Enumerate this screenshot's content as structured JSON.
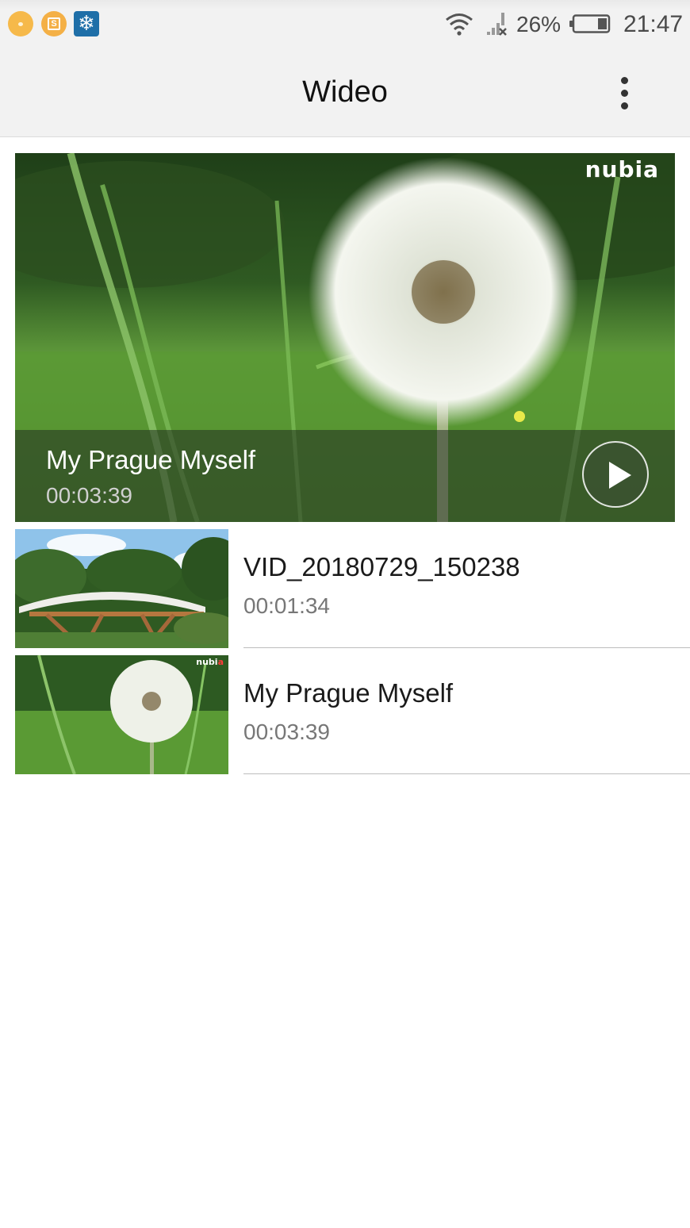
{
  "status_bar": {
    "notification_icons": [
      "notification-icon",
      "slides-app-icon",
      "snowflake-app-icon"
    ],
    "battery_percent": "26%",
    "time": "21:47"
  },
  "app_bar": {
    "title": "Wideo",
    "menu_icon": "more-vert-icon"
  },
  "featured": {
    "title": "My Prague Myself",
    "duration": "00:03:39",
    "brand": "nubia",
    "play_icon": "play-icon"
  },
  "videos": [
    {
      "title": "VID_20180729_150238",
      "duration": "00:01:34"
    },
    {
      "title": "My Prague Myself",
      "duration": "00:03:39"
    }
  ],
  "colors": {
    "app_bar_bg": "#f2f2f2",
    "divider": "#bdbdbd",
    "secondary_text": "#777777",
    "brand_accent": "#ff3b3b"
  }
}
